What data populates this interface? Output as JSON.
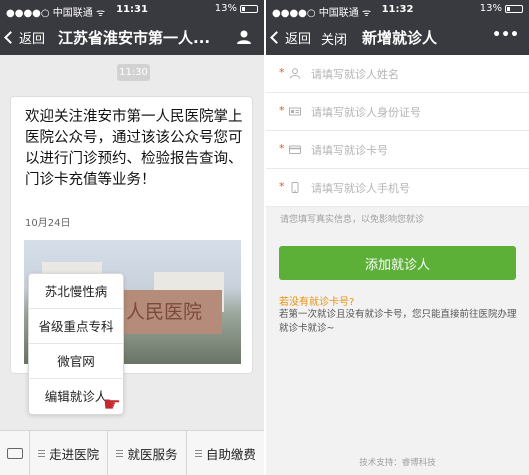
{
  "left": {
    "status": {
      "carrier": "●●●●○ 中国联通 ᯤ",
      "time": "11:31",
      "battery": "13%"
    },
    "nav": {
      "back": "返回",
      "title": "江苏省淮安市第一人..."
    },
    "chat_time": "11:30",
    "message": {
      "text": "欢迎关注淮安市第一人民医院掌上医院公众号，通过该该公众号您可以进行门诊预约、检验报告查询、门诊卡充值等业务！",
      "date": "10月24日",
      "photo_sign": "人民医院"
    },
    "popup_menu": [
      "苏北慢性病",
      "省级重点专科",
      "微官网",
      "编辑就诊人"
    ],
    "bottom_menu": [
      "走进医院",
      "就医服务",
      "自助缴费"
    ]
  },
  "right": {
    "status": {
      "carrier": "●●●●○ 中国联通 ᯤ",
      "time": "11:32",
      "battery": "13%"
    },
    "nav": {
      "back": "返回",
      "close": "关闭",
      "title": "新增就诊人",
      "more": "•••"
    },
    "fields": [
      {
        "icon": "person-icon",
        "required": "*",
        "placeholder": "请填写就诊人姓名"
      },
      {
        "icon": "id-card-icon",
        "required": "*",
        "placeholder": "请填写就诊人身份证号"
      },
      {
        "icon": "card-icon",
        "required": "*",
        "placeholder": "请填写就诊卡号"
      },
      {
        "icon": "phone-icon",
        "required": "*",
        "placeholder": "请填写就诊人手机号"
      }
    ],
    "hint": "请您填写真实信息，以免影响您就诊",
    "add_button": "添加就诊人",
    "no_card_link": "若没有就诊卡号?",
    "note": "若第一次就诊且没有就诊卡号，您只能直接前往医院办理就诊卡就诊~",
    "support": "技术支持：睿博科技"
  },
  "colors": {
    "nav_bg": "#393a3f",
    "primary_button": "#5cb038",
    "link": "#e8930d",
    "required_star": "#e05a2b"
  }
}
